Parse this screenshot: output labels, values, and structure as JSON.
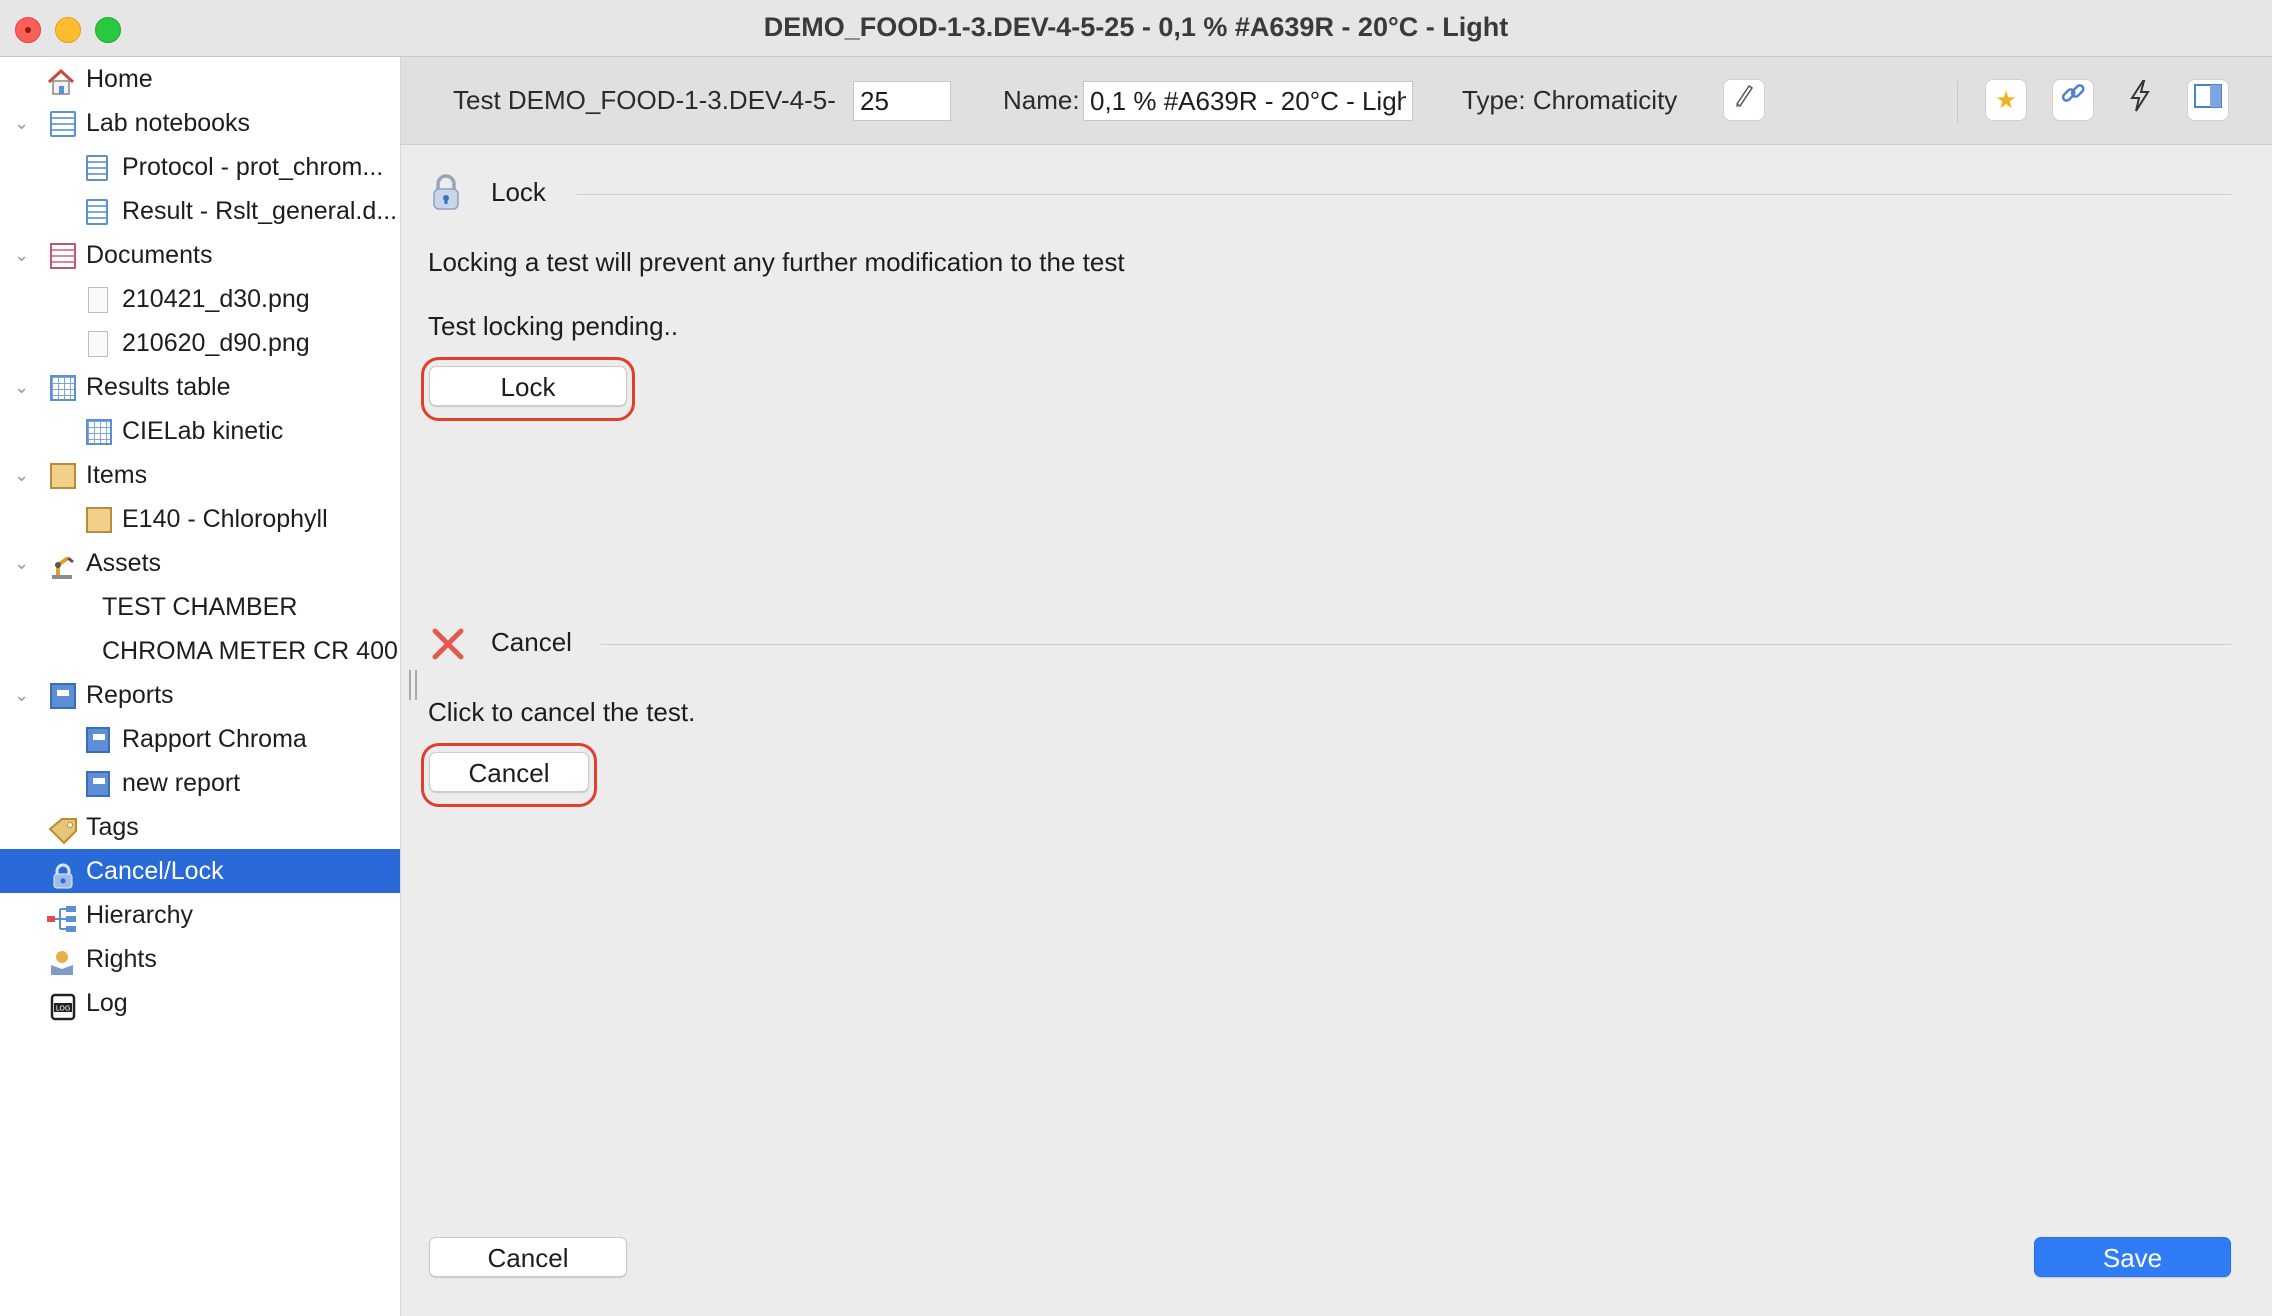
{
  "window": {
    "title": "DEMO_FOOD-1-3.DEV-4-5-25 - 0,1 % #A639R - 20°C - Light"
  },
  "sidebar": {
    "items": [
      {
        "label": "Home",
        "icon": "home-icon"
      },
      {
        "label": "Lab notebooks",
        "icon": "notebook-icon"
      },
      {
        "label": "Protocol - prot_chrom...",
        "icon": "document-icon"
      },
      {
        "label": "Result - Rslt_general.d...",
        "icon": "document-icon"
      },
      {
        "label": "Documents",
        "icon": "documents-icon"
      },
      {
        "label": "210421_d30.png",
        "icon": "file-icon"
      },
      {
        "label": "210620_d90.png",
        "icon": "file-icon"
      },
      {
        "label": "Results table",
        "icon": "table-icon"
      },
      {
        "label": "CIELab kinetic",
        "icon": "table-icon"
      },
      {
        "label": "Items",
        "icon": "box-icon"
      },
      {
        "label": "E140 - Chlorophyll",
        "icon": "box-icon"
      },
      {
        "label": "Assets",
        "icon": "robot-arm-icon"
      },
      {
        "label": "TEST CHAMBER",
        "icon": ""
      },
      {
        "label": "CHROMA METER CR 400",
        "icon": ""
      },
      {
        "label": "Reports",
        "icon": "report-icon"
      },
      {
        "label": "Rapport Chroma",
        "icon": "report-icon"
      },
      {
        "label": "new report",
        "icon": "report-icon"
      },
      {
        "label": "Tags",
        "icon": "tag-icon"
      },
      {
        "label": "Cancel/Lock",
        "icon": "lock-icon"
      },
      {
        "label": "Hierarchy",
        "icon": "hierarchy-icon"
      },
      {
        "label": "Rights",
        "icon": "rights-icon"
      },
      {
        "label": "Log",
        "icon": "log-icon"
      }
    ],
    "selected": "Cancel/Lock"
  },
  "toolbar": {
    "test_label": "Test DEMO_FOOD-1-3.DEV-4-5-",
    "test_number": "25",
    "name_label": "Name:",
    "name_value": "0,1 % #A639R - 20°C - Light",
    "type_label": "Type: Chromaticity",
    "buttons": [
      "edit-icon",
      "star-icon",
      "link-icon",
      "lightning-icon",
      "panel-icon"
    ]
  },
  "lock_section": {
    "heading": "Lock",
    "description": "Locking a test will prevent any further modification to the test",
    "status": "Test locking pending..",
    "button": "Lock"
  },
  "cancel_section": {
    "heading": "Cancel",
    "description": "Click to cancel the test.",
    "button": "Cancel"
  },
  "footer": {
    "cancel": "Cancel",
    "save": "Save"
  },
  "colors": {
    "selection": "#2a6ad8",
    "highlight": "#e0402a",
    "primary": "#2f7cf6"
  }
}
